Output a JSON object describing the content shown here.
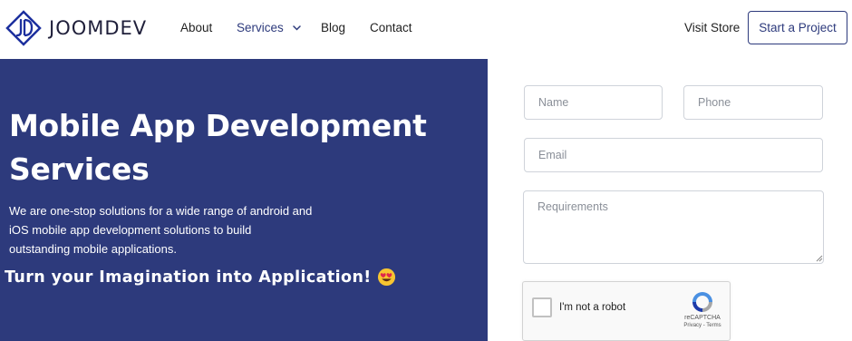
{
  "header": {
    "logo_text": "JOOMDEV",
    "nav": [
      {
        "label": "About"
      },
      {
        "label": "Services"
      },
      {
        "label": "Blog"
      },
      {
        "label": "Contact"
      }
    ],
    "visit_store": "Visit Store",
    "cta_label": "Start a Project"
  },
  "hero": {
    "title": "Mobile App Development Services",
    "description": "We are one-stop solutions for a wide range of android and iOS mobile app development solutions to build outstanding mobile applications.",
    "tagline": "Turn your Imagination into Application!"
  },
  "form": {
    "name_placeholder": "Name",
    "phone_placeholder": "Phone",
    "email_placeholder": "Email",
    "requirements_placeholder": "Requirements",
    "recaptcha": {
      "label": "I'm not a robot",
      "brand": "reCAPTCHA",
      "links": "Privacy - Terms"
    }
  },
  "colors": {
    "brand_navy": "#2d3a7c",
    "logo_blue": "#1c2f9e"
  },
  "icons": [
    "jd-logo-icon",
    "chevron-down-icon",
    "heart-eyes-emoji-icon",
    "recaptcha-logo-icon",
    "resize-grip-icon"
  ]
}
